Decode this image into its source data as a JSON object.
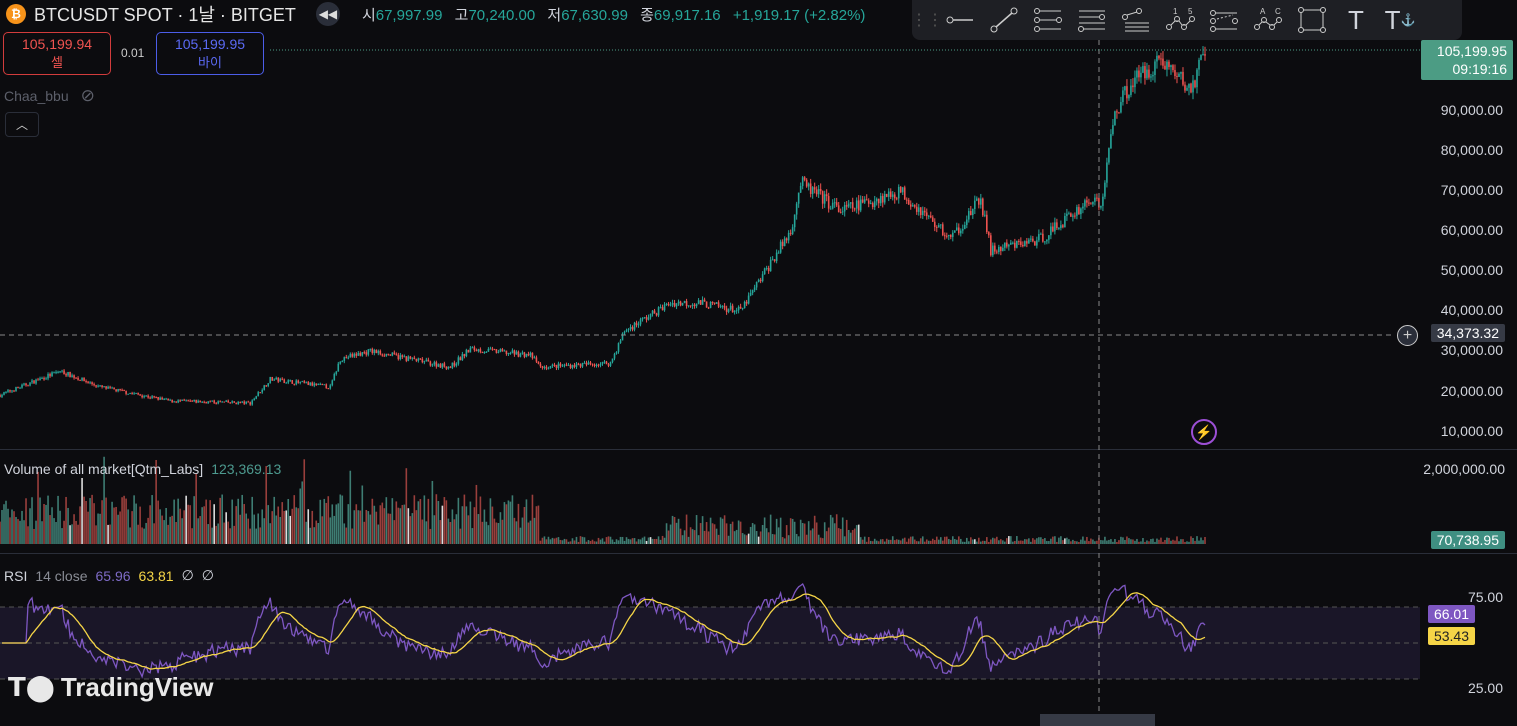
{
  "header": {
    "symbol_title": "BTCUSDT SPOT · 1날 · BITGET",
    "coin_glyph": "₿",
    "ohlc": [
      {
        "label": "시",
        "value": "67,997.99"
      },
      {
        "label": "고",
        "value": "70,240.00"
      },
      {
        "label": "저",
        "value": "67,630.99"
      },
      {
        "label": "종",
        "value": "69,917.16"
      }
    ],
    "change": "+1,919.17 (+2.82%)"
  },
  "trade": {
    "sell_price": "105,199.94",
    "sell_label": "셀",
    "spread": "0.01",
    "buy_price": "105,199.95",
    "buy_label": "바이"
  },
  "account": {
    "name": "Chaa_bbu"
  },
  "toolbar": {
    "tools": [
      "horizontal-ray",
      "trend-line",
      "fib-retracement",
      "parallel-lines",
      "fib-fan",
      "elliott-wave",
      "pitchfork",
      "abcd-pattern",
      "rectangle",
      "text",
      "anchored-text"
    ],
    "wave_labels": [
      "1",
      "5"
    ],
    "abcd_labels": [
      "A",
      "C"
    ]
  },
  "price_axis": {
    "ticks": [
      "90,000.00",
      "80,000.00",
      "70,000.00",
      "60,000.00",
      "50,000.00",
      "40,000.00",
      "30,000.00",
      "20,000.00",
      "10,000.00"
    ],
    "last_price": "105,199.95",
    "countdown": "09:19:16",
    "crosshair_price": "34,373.32"
  },
  "volume": {
    "title": "Volume of all market[Qtm_Labs]",
    "value": "123,369.13",
    "axis_top": "2,000,000.00",
    "last": "70,738.95"
  },
  "rsi": {
    "title": "RSI",
    "params": "14 close",
    "rsi_value": "65.96",
    "ma_value": "63.81",
    "extra": [
      "∅",
      "∅"
    ],
    "axis": [
      "75.00",
      "25.00"
    ],
    "rsi_tag": "66.01",
    "ma_tag": "53.43"
  },
  "branding": {
    "logo": "TradingView"
  },
  "colors": {
    "up": "#26a69a",
    "down": "#ef5350",
    "rsi": "#7e57c2",
    "ma": "#f5d547",
    "bg": "#0c0c0f"
  },
  "chart_data": {
    "type": "candlestick",
    "symbol": "BTCUSDT",
    "interval": "1D",
    "ylim": [
      10000,
      107000
    ],
    "waypoints_day_price": [
      [
        0,
        19000
      ],
      [
        30,
        25000
      ],
      [
        50,
        21000
      ],
      [
        85,
        17500
      ],
      [
        125,
        17000
      ],
      [
        135,
        23000
      ],
      [
        165,
        21000
      ],
      [
        170,
        28000
      ],
      [
        185,
        30000
      ],
      [
        225,
        26000
      ],
      [
        235,
        30500
      ],
      [
        265,
        29000
      ],
      [
        270,
        26000
      ],
      [
        305,
        27000
      ],
      [
        312,
        35000
      ],
      [
        335,
        42000
      ],
      [
        350,
        42000
      ],
      [
        370,
        40000
      ],
      [
        385,
        52000
      ],
      [
        395,
        60000
      ],
      [
        400,
        72000
      ],
      [
        420,
        65000
      ],
      [
        450,
        70000
      ],
      [
        475,
        58000
      ],
      [
        490,
        68000
      ],
      [
        495,
        55000
      ],
      [
        520,
        58000
      ],
      [
        530,
        62000
      ],
      [
        545,
        68000
      ],
      [
        550,
        66000
      ],
      [
        557,
        90000
      ],
      [
        565,
        97000
      ],
      [
        580,
        103000
      ],
      [
        595,
        95000
      ],
      [
        602,
        105000
      ]
    ]
  }
}
